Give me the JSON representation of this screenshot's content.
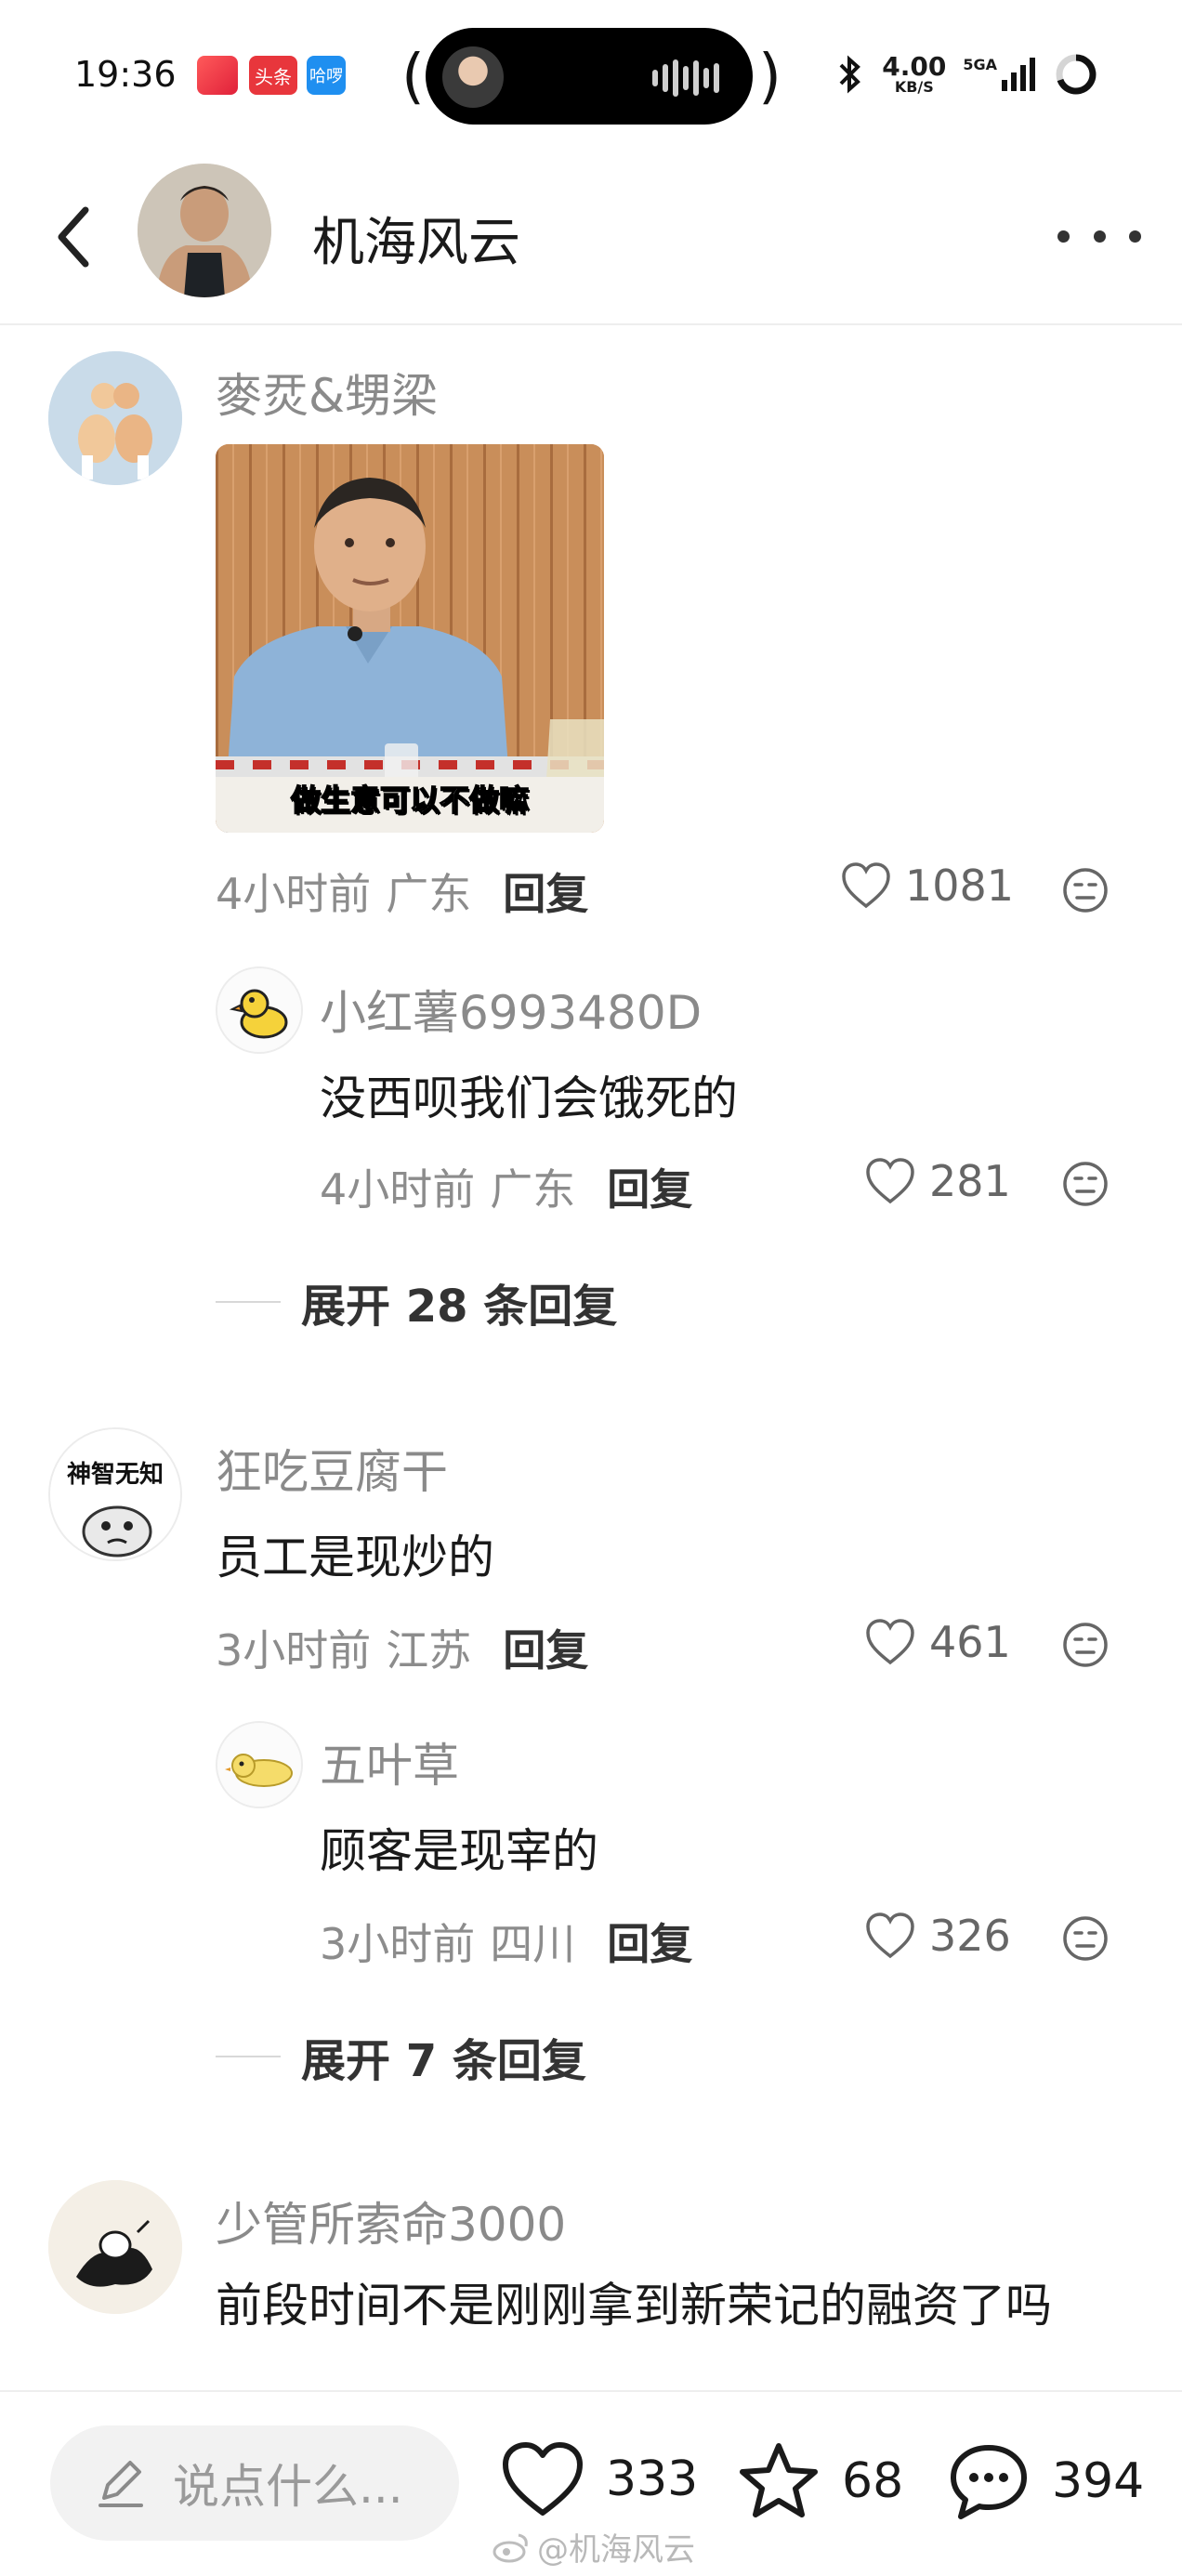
{
  "status_bar": {
    "time": "19:36",
    "app_badges": [
      "头条",
      "哈啰"
    ],
    "network_speed": "4.00",
    "network_unit": "KB/S",
    "signal_label": "5GA"
  },
  "header": {
    "title": "机海风云"
  },
  "comments": [
    {
      "username": "麥烎&甥梁",
      "image_caption": "做生意可以不做嘛",
      "meta_time": "4小时前",
      "meta_location": "广东",
      "reply_label": "回复",
      "likes": "1081",
      "replies": [
        {
          "username": "小红薯6993480D",
          "text": "没西呗我们会饿死的",
          "meta_time": "4小时前",
          "meta_location": "广东",
          "reply_label": "回复",
          "likes": "281"
        }
      ],
      "expand_label": "展开 28 条回复"
    },
    {
      "username": "狂吃豆腐干",
      "avatar_text": "神智无知",
      "text": "员工是现炒的",
      "meta_time": "3小时前",
      "meta_location": "江苏",
      "reply_label": "回复",
      "likes": "461",
      "replies": [
        {
          "username": "五叶草",
          "text": "顾客是现宰的",
          "meta_time": "3小时前",
          "meta_location": "四川",
          "reply_label": "回复",
          "likes": "326"
        }
      ],
      "expand_label": "展开 7 条回复"
    },
    {
      "username": "少管所索命3000",
      "text": "前段时间不是刚刚拿到新荣记的融资了吗"
    }
  ],
  "bottom_bar": {
    "input_placeholder": "说点什么...",
    "like_count": "333",
    "star_count": "68",
    "comment_count": "394"
  },
  "watermark": "@机海风云",
  "colors": {
    "text_primary": "#1a1a1a",
    "text_secondary": "#8a8a8a",
    "divider": "#eeeeee",
    "input_bg": "#f2f2f2"
  }
}
